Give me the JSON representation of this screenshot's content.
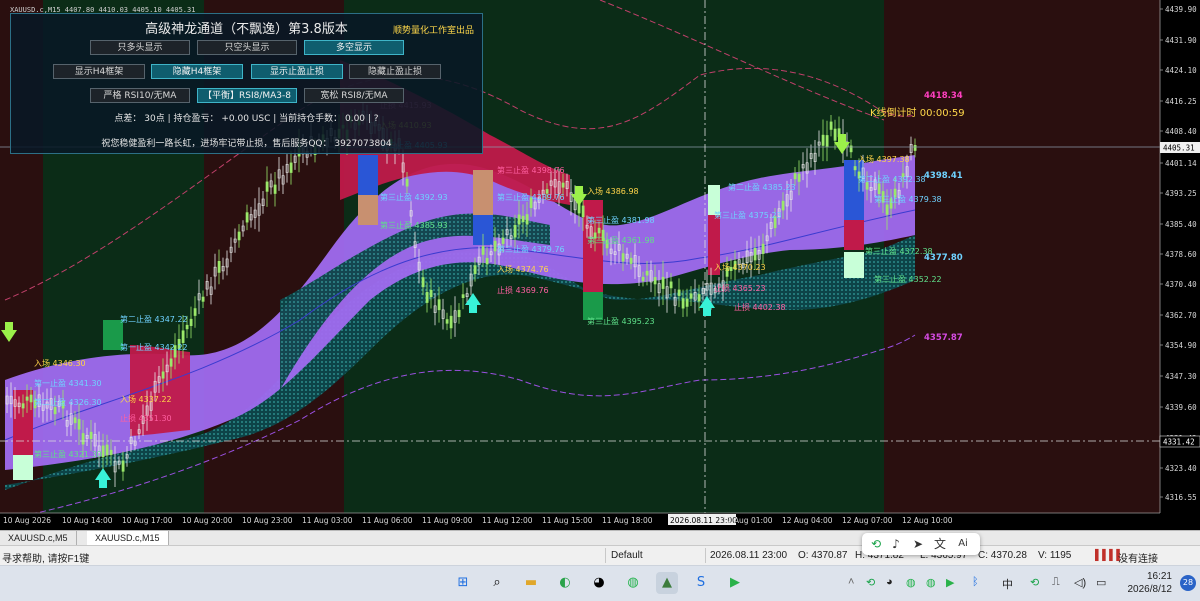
{
  "chart": {
    "symbol_line": "XAUUSD.c,M15  4407.80 4410.03 4405.10 4405.31",
    "price_ticks": [
      "4439.90",
      "4431.90",
      "4424.10",
      "4416.25",
      "4408.40",
      "4401.14",
      "4393.25",
      "4385.40",
      "4378.60",
      "4370.40",
      "4362.70",
      "4354.90",
      "4347.30",
      "4339.60",
      "4331.42",
      "4323.40",
      "4316.55"
    ],
    "current_price": "4405.31",
    "hline_price": "4331.42",
    "time_ticks": [
      "10 Aug 2026",
      "10 Aug 14:00",
      "10 Aug 17:00",
      "10 Aug 20:00",
      "10 Aug 23:00",
      "11 Aug 03:00",
      "11 Aug 06:00",
      "11 Aug 09:00",
      "11 Aug 12:00",
      "11 Aug 15:00",
      "11 Aug 18:00",
      "2026.08.11 23:00",
      "12 Aug 01:00",
      "12 Aug 04:00",
      "12 Aug 07:00",
      "12 Aug 10:00"
    ],
    "countdown": "K线倒计时  00:00:59",
    "right_levels": [
      {
        "text": "4418.34",
        "color": "#ff3fc0"
      },
      {
        "text": "4398.41",
        "color": "#6fd2ff"
      },
      {
        "text": "4377.80",
        "color": "#6fd2ff"
      },
      {
        "text": "4357.87",
        "color": "#d44be0"
      }
    ],
    "annotations": [
      {
        "text": "止损  4415.93",
        "color": "#ff5fa0"
      },
      {
        "text": "入场  4410.93",
        "color": "#ffd44a"
      },
      {
        "text": "第三止盈  4405.93",
        "color": "#6fd2ff"
      },
      {
        "text": "第三止盈  4392.93",
        "color": "#6fd2ff"
      },
      {
        "text": "第三止盈  4385.93",
        "color": "#5fe08a"
      },
      {
        "text": "第三止盈  4398.76",
        "color": "#ff5fa0"
      },
      {
        "text": "第三止盈  4389.76",
        "color": "#6fd2ff"
      },
      {
        "text": "第三止盈  4379.76",
        "color": "#6fd2ff"
      },
      {
        "text": "入场  4374.76",
        "color": "#ffd44a"
      },
      {
        "text": "止损  4369.76",
        "color": "#ff5fa0"
      },
      {
        "text": "入场  4386.98",
        "color": "#ffd44a"
      },
      {
        "text": "第三止盈  4381.98",
        "color": "#6fd2ff"
      },
      {
        "text": "第三止盈  4361.98",
        "color": "#5fe08a"
      },
      {
        "text": "第三止盈  4395.23",
        "color": "#5fe08a"
      },
      {
        "text": "第二止盈  4385.23",
        "color": "#6fd2ff"
      },
      {
        "text": "第三止盈  4375.23",
        "color": "#6fd2ff"
      },
      {
        "text": "入场  4370.23",
        "color": "#ffd44a"
      },
      {
        "text": "止损  4365.23",
        "color": "#ff5fa0"
      },
      {
        "text": "止损  4402.38",
        "color": "#ff5fa0"
      },
      {
        "text": "入场  4397.38",
        "color": "#ffd44a"
      },
      {
        "text": "第二止盈  4392.38",
        "color": "#6fd2ff"
      },
      {
        "text": "第三止盈  4379.38",
        "color": "#6fd2ff"
      },
      {
        "text": "第三止盈  4372.38",
        "color": "#5fe08a"
      },
      {
        "text": "第三止盈  4352.22",
        "color": "#5fe08a"
      },
      {
        "text": "第二止盈  4347.22",
        "color": "#6fd2ff"
      },
      {
        "text": "第一止盈  4342.22",
        "color": "#6fd2ff"
      },
      {
        "text": "入场  4337.22",
        "color": "#ffd44a"
      },
      {
        "text": "止损  4351.30",
        "color": "#ff5fa0"
      },
      {
        "text": "入场  4346.30",
        "color": "#ffd44a"
      },
      {
        "text": "第一止盈  4341.30",
        "color": "#6fd2ff"
      },
      {
        "text": "第二止盈  4326.30",
        "color": "#6fd2ff"
      },
      {
        "text": "第三止盈  4321.30",
        "color": "#5fe08a"
      }
    ]
  },
  "panel": {
    "title": "高级神龙通道（不飘逸）第3.8版本",
    "studio": "顺势量化工作室出品",
    "row1": [
      "只多头显示",
      "只空头显示",
      "多空显示"
    ],
    "row2": [
      "显示H4框架",
      "隐藏H4框架",
      "显示止盈止损",
      "隐藏止盈止损"
    ],
    "row3": [
      "严格 RSI10/无MA",
      "【平衡】RSI8/MA3-8",
      "宽松 RSI8/无MA"
    ],
    "info": "点差： 30点  |  持仓盈亏： +0.00 USC  |  当前持仓手数： 0.00  |  ?",
    "footer": "祝您稳健盈利一路长虹，进场牢记带止损，售后服务QQ： 3927073804"
  },
  "tabs": [
    "XAUUSD.c,M5",
    "XAUUSD.c,M15"
  ],
  "status": {
    "help": "寻求帮助, 请按F1键",
    "profile": "Default",
    "datetime": "2026.08.11 23:00",
    "open": "O: 4370.87",
    "high": "H: 4371.82",
    "low": "L: 4365.97",
    "close": "C: 4370.28",
    "volume": "V: 1195",
    "connection": "没有连接"
  },
  "taskbar": {
    "ime": "中",
    "time": "16:21",
    "date": "2026/8/12",
    "badge": "28"
  },
  "colors": {
    "bg_red": "#2a0f0f",
    "bg_green": "#0b2c17",
    "channel": "#a06cf0",
    "channel_red": "#c01a4a",
    "channel_green": "#1e6b6b",
    "bull": "#9be86a",
    "bear": "#e8e8e8"
  }
}
